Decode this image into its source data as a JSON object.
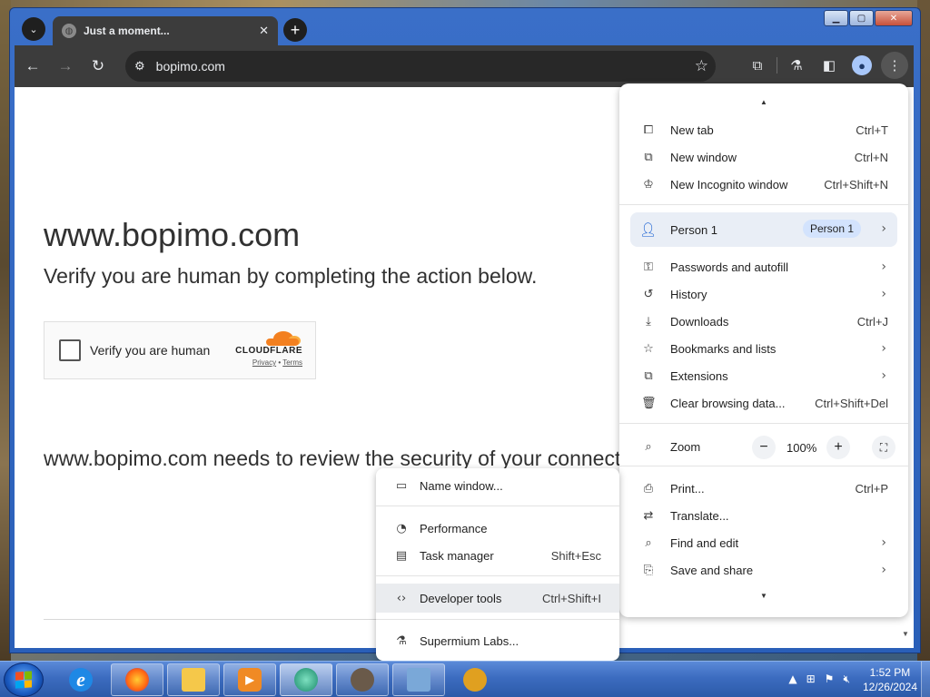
{
  "browser": {
    "tab": {
      "title": "Just a moment..."
    },
    "address": {
      "url": "bopimo.com"
    }
  },
  "page": {
    "site_title": "www.bopimo.com",
    "subtitle": "Verify you are human by completing the action below.",
    "captcha": {
      "label": "Verify you are human",
      "brand": "CLOUDFLARE",
      "privacy": "Privacy",
      "separator": "•",
      "terms": "Terms"
    },
    "review_text": "www.bopimo.com needs to review the security of your connection before proceeding."
  },
  "menu": {
    "items": [
      {
        "label": "New tab",
        "shortcut": "Ctrl+T",
        "icon": "new-tab-icon"
      },
      {
        "label": "New window",
        "shortcut": "Ctrl+N",
        "icon": "new-window-icon"
      },
      {
        "label": "New Incognito window",
        "shortcut": "Ctrl+Shift+N",
        "icon": "incognito-icon"
      }
    ],
    "person": {
      "label": "Person 1",
      "chip": "Person 1"
    },
    "items2": [
      {
        "label": "Passwords and autofill",
        "icon": "key-icon"
      },
      {
        "label": "History",
        "icon": "history-icon"
      },
      {
        "label": "Downloads",
        "shortcut": "Ctrl+J",
        "icon": "download-icon"
      },
      {
        "label": "Bookmarks and lists",
        "icon": "star-icon"
      },
      {
        "label": "Extensions",
        "icon": "puzzle-icon"
      },
      {
        "label": "Clear browsing data...",
        "shortcut": "Ctrl+Shift+Del",
        "icon": "trash-icon"
      }
    ],
    "zoom": {
      "label": "Zoom",
      "value": "100%",
      "minus": "−",
      "plus": "+"
    },
    "items3": [
      {
        "label": "Print...",
        "shortcut": "Ctrl+P",
        "icon": "print-icon"
      },
      {
        "label": "Translate...",
        "icon": "translate-icon"
      },
      {
        "label": "Find and edit",
        "icon": "find-icon"
      },
      {
        "label": "Save and share",
        "icon": "save-share-icon"
      }
    ]
  },
  "submenu": {
    "items": [
      {
        "label": "Name window...",
        "icon": "window-icon"
      },
      {
        "label": "Performance",
        "icon": "gauge-icon"
      },
      {
        "label": "Task manager",
        "shortcut": "Shift+Esc",
        "icon": "task-manager-icon"
      },
      {
        "label": "Developer tools",
        "shortcut": "Ctrl+Shift+I",
        "icon": "code-icon"
      },
      {
        "label": "Supermium Labs...",
        "icon": "flask-icon"
      }
    ]
  },
  "taskbar": {
    "time": "1:52 PM",
    "date": "12/26/2024"
  }
}
